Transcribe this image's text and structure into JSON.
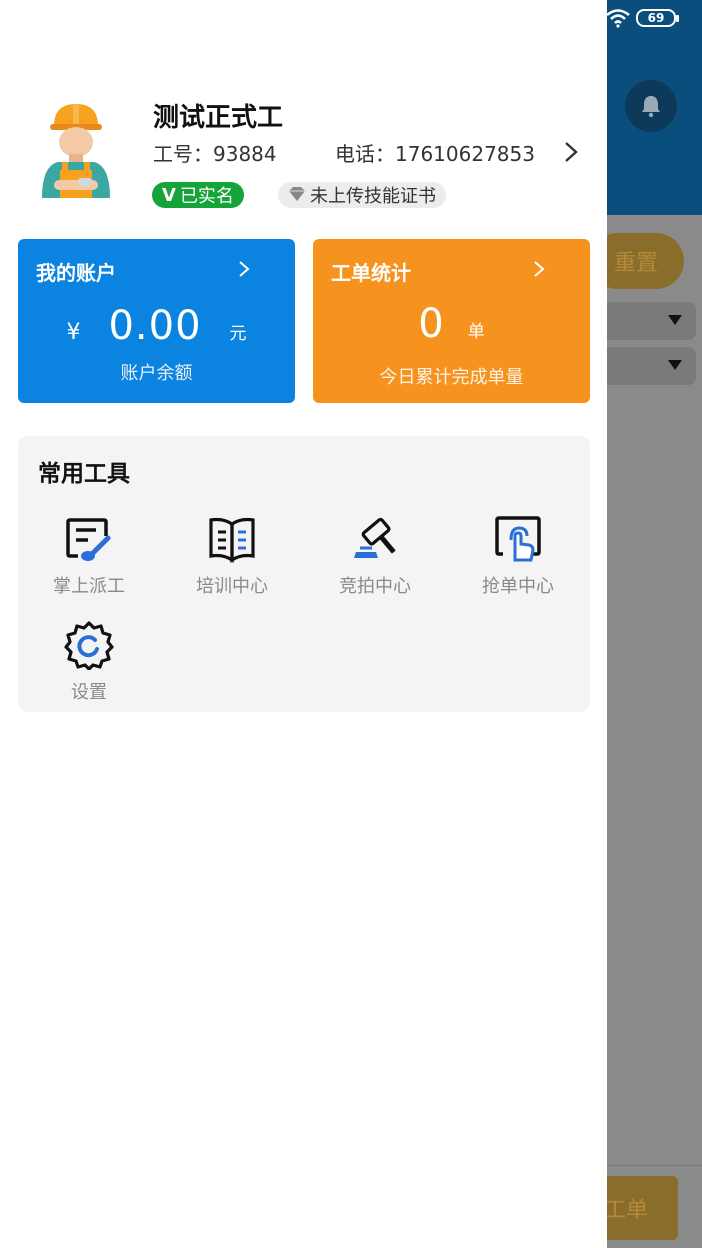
{
  "status_bar": {
    "battery": "69",
    "icons": [
      "wifi-icon",
      "battery-icon"
    ]
  },
  "background": {
    "reset_button": "重置",
    "order_button": "工单",
    "icons": [
      "bell-icon",
      "caret-down-icon"
    ]
  },
  "profile": {
    "name": "测试正式工",
    "employee_id": "工号：93884",
    "phone": "电话：17610627853",
    "badges": {
      "verified": "已实名",
      "verified_mark": "V",
      "certificate": "未上传技能证书"
    },
    "icons": [
      "worker-avatar",
      "chevron-right-icon",
      "diamond-icon"
    ]
  },
  "account_card": {
    "title": "我的账户",
    "currency": "¥",
    "amount": "0.00",
    "unit": "元",
    "subtitle": "账户余额",
    "color": "#0b83e0"
  },
  "orders_card": {
    "title": "工单统计",
    "count": "0",
    "unit": "单",
    "subtitle": "今日累计完成单量",
    "color": "#f6931f"
  },
  "tools": {
    "title": "常用工具",
    "items": [
      {
        "label": "掌上派工",
        "icon": "dispatch-icon"
      },
      {
        "label": "培训中心",
        "icon": "book-icon"
      },
      {
        "label": "竞拍中心",
        "icon": "gavel-icon"
      },
      {
        "label": "抢单中心",
        "icon": "tap-icon"
      },
      {
        "label": "设置",
        "icon": "gear-icon"
      }
    ]
  }
}
